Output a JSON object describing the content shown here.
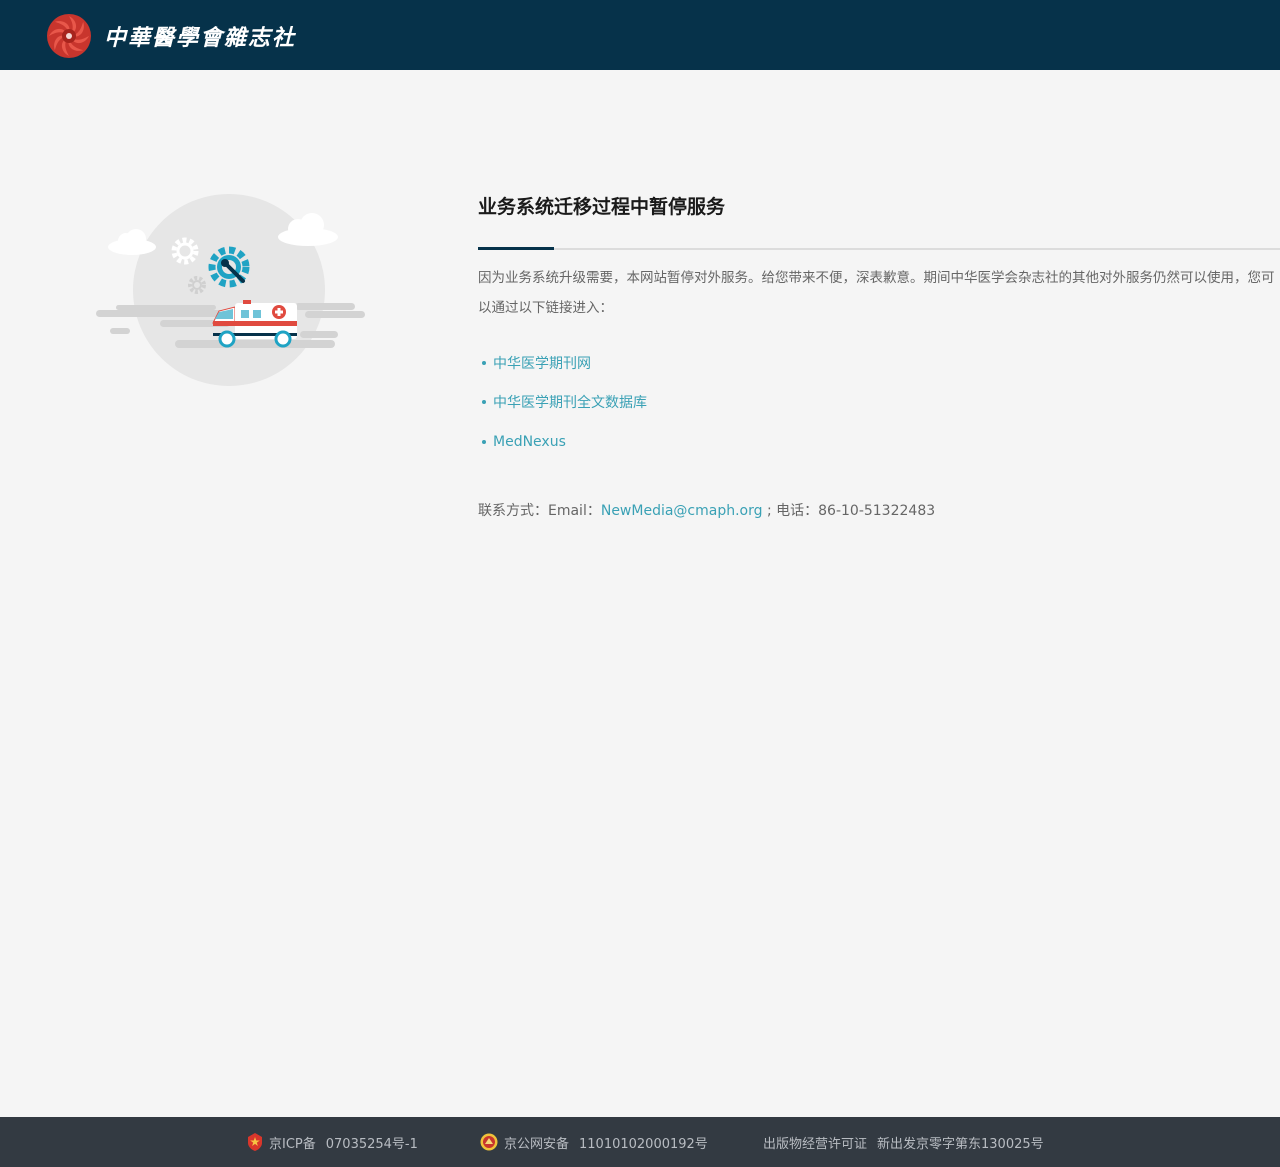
{
  "header": {
    "org_name": "中華醫學會雜志社",
    "logo_icon": "cma-flower-logo-icon"
  },
  "colors": {
    "header_bg": "#06324a",
    "accent": "#3aa1b5",
    "footer_bg": "#333a42",
    "page_bg": "#f5f5f5"
  },
  "illustration": {
    "icons": [
      "gear-icon",
      "wrench-icon",
      "ambulance-icon",
      "cloud-icon"
    ]
  },
  "main": {
    "title": "业务系统迁移过程中暂停服务",
    "description": "因为业务系统升级需要，本网站暂停对外服务。给您带来不便，深表歉意。期间中华医学会杂志社的其他对外服务仍然可以使用，您可以通过以下链接进入：",
    "links": [
      {
        "label": "中华医学期刊网"
      },
      {
        "label": "中华医学期刊全文数据库"
      },
      {
        "label": "MedNexus"
      }
    ],
    "contact": {
      "prefix": "联系方式：Email：",
      "email": "NewMedia@cmaph.org",
      "separator": " ; ",
      "phone": "电话：86-10-51322483"
    }
  },
  "footer": {
    "icp_label": "京ICP备",
    "icp_number": "07035254号-1",
    "police_label": "京公网安备",
    "police_number": "11010102000192号",
    "license_label": "出版物经营许可证",
    "license_number": "新出发京零字第东130025号"
  }
}
